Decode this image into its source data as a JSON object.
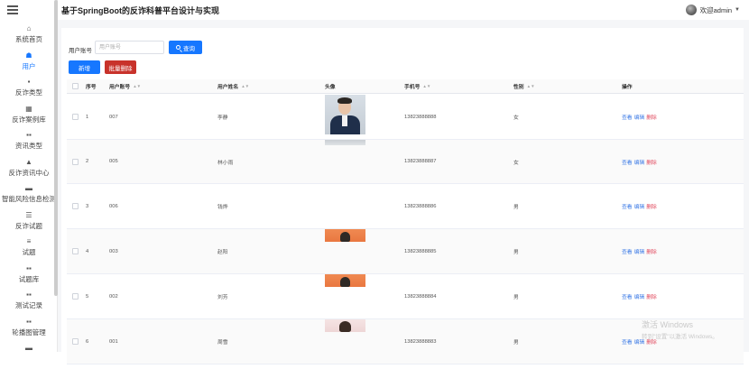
{
  "app": {
    "title": "基于SpringBoot的反诈科普平台设计与实现",
    "welcome": "欢迎admin"
  },
  "sidebar": {
    "items": [
      {
        "label": "系统首页",
        "icon": "home-icon",
        "glyph": "⌂"
      },
      {
        "label": "用户",
        "icon": "user-icon",
        "glyph": "☗",
        "active": true
      },
      {
        "label": "反诈类型",
        "icon": "grid-icon",
        "glyph": "▪"
      },
      {
        "label": "反诈案例库",
        "icon": "grid-icon",
        "glyph": "▦"
      },
      {
        "label": "资讯类型",
        "icon": "grid-icon",
        "glyph": "▪▪"
      },
      {
        "label": "反诈资讯中心",
        "icon": "person-icon",
        "glyph": "▲"
      },
      {
        "label": "智能风险信息检测",
        "icon": "folder-icon",
        "glyph": "▬"
      },
      {
        "label": "反诈试题",
        "icon": "list-icon",
        "glyph": "☰"
      },
      {
        "label": "试题",
        "icon": "list-icon",
        "glyph": "≡"
      },
      {
        "label": "试题库",
        "icon": "grid-icon",
        "glyph": "▪▪"
      },
      {
        "label": "测试记录",
        "icon": "grid-icon",
        "glyph": "▪▪"
      },
      {
        "label": "轮播图管理",
        "icon": "grid-icon",
        "glyph": "▪▪"
      },
      {
        "label": "",
        "icon": "grid-icon",
        "glyph": "▬"
      }
    ]
  },
  "search": {
    "label": "用户账号",
    "placeholder": "用户账号",
    "button": "查询"
  },
  "actions": {
    "add": "新增",
    "bulk_delete": "批量删除"
  },
  "table": {
    "headers": {
      "index": "序号",
      "account": "用户账号",
      "name": "用户姓名",
      "avatar": "头像",
      "phone": "手机号",
      "gender": "性别",
      "ops": "操作"
    },
    "ops": {
      "view": "查看",
      "edit": "编辑",
      "delete": "删除"
    },
    "rows": [
      {
        "index": "1",
        "account": "007",
        "name": "李静",
        "phone": "13823888888",
        "gender": "女",
        "photo": "suit"
      },
      {
        "index": "2",
        "account": "005",
        "name": "林小雨",
        "phone": "13823888887",
        "gender": "女",
        "photo": "thin"
      },
      {
        "index": "3",
        "account": "006",
        "name": "钱烨",
        "phone": "13823888886",
        "gender": "男",
        "photo": "none"
      },
      {
        "index": "4",
        "account": "003",
        "name": "赵阳",
        "phone": "13823888885",
        "gender": "男",
        "photo": "orange"
      },
      {
        "index": "5",
        "account": "002",
        "name": "刘芳",
        "phone": "13823888884",
        "gender": "男",
        "photo": "orange"
      },
      {
        "index": "6",
        "account": "001",
        "name": "周雪",
        "phone": "13823888883",
        "gender": "男",
        "photo": "pink"
      }
    ]
  },
  "watermark": {
    "line1": "激活 Windows",
    "line2": "转到\"设置\"以激活 Windows。"
  }
}
